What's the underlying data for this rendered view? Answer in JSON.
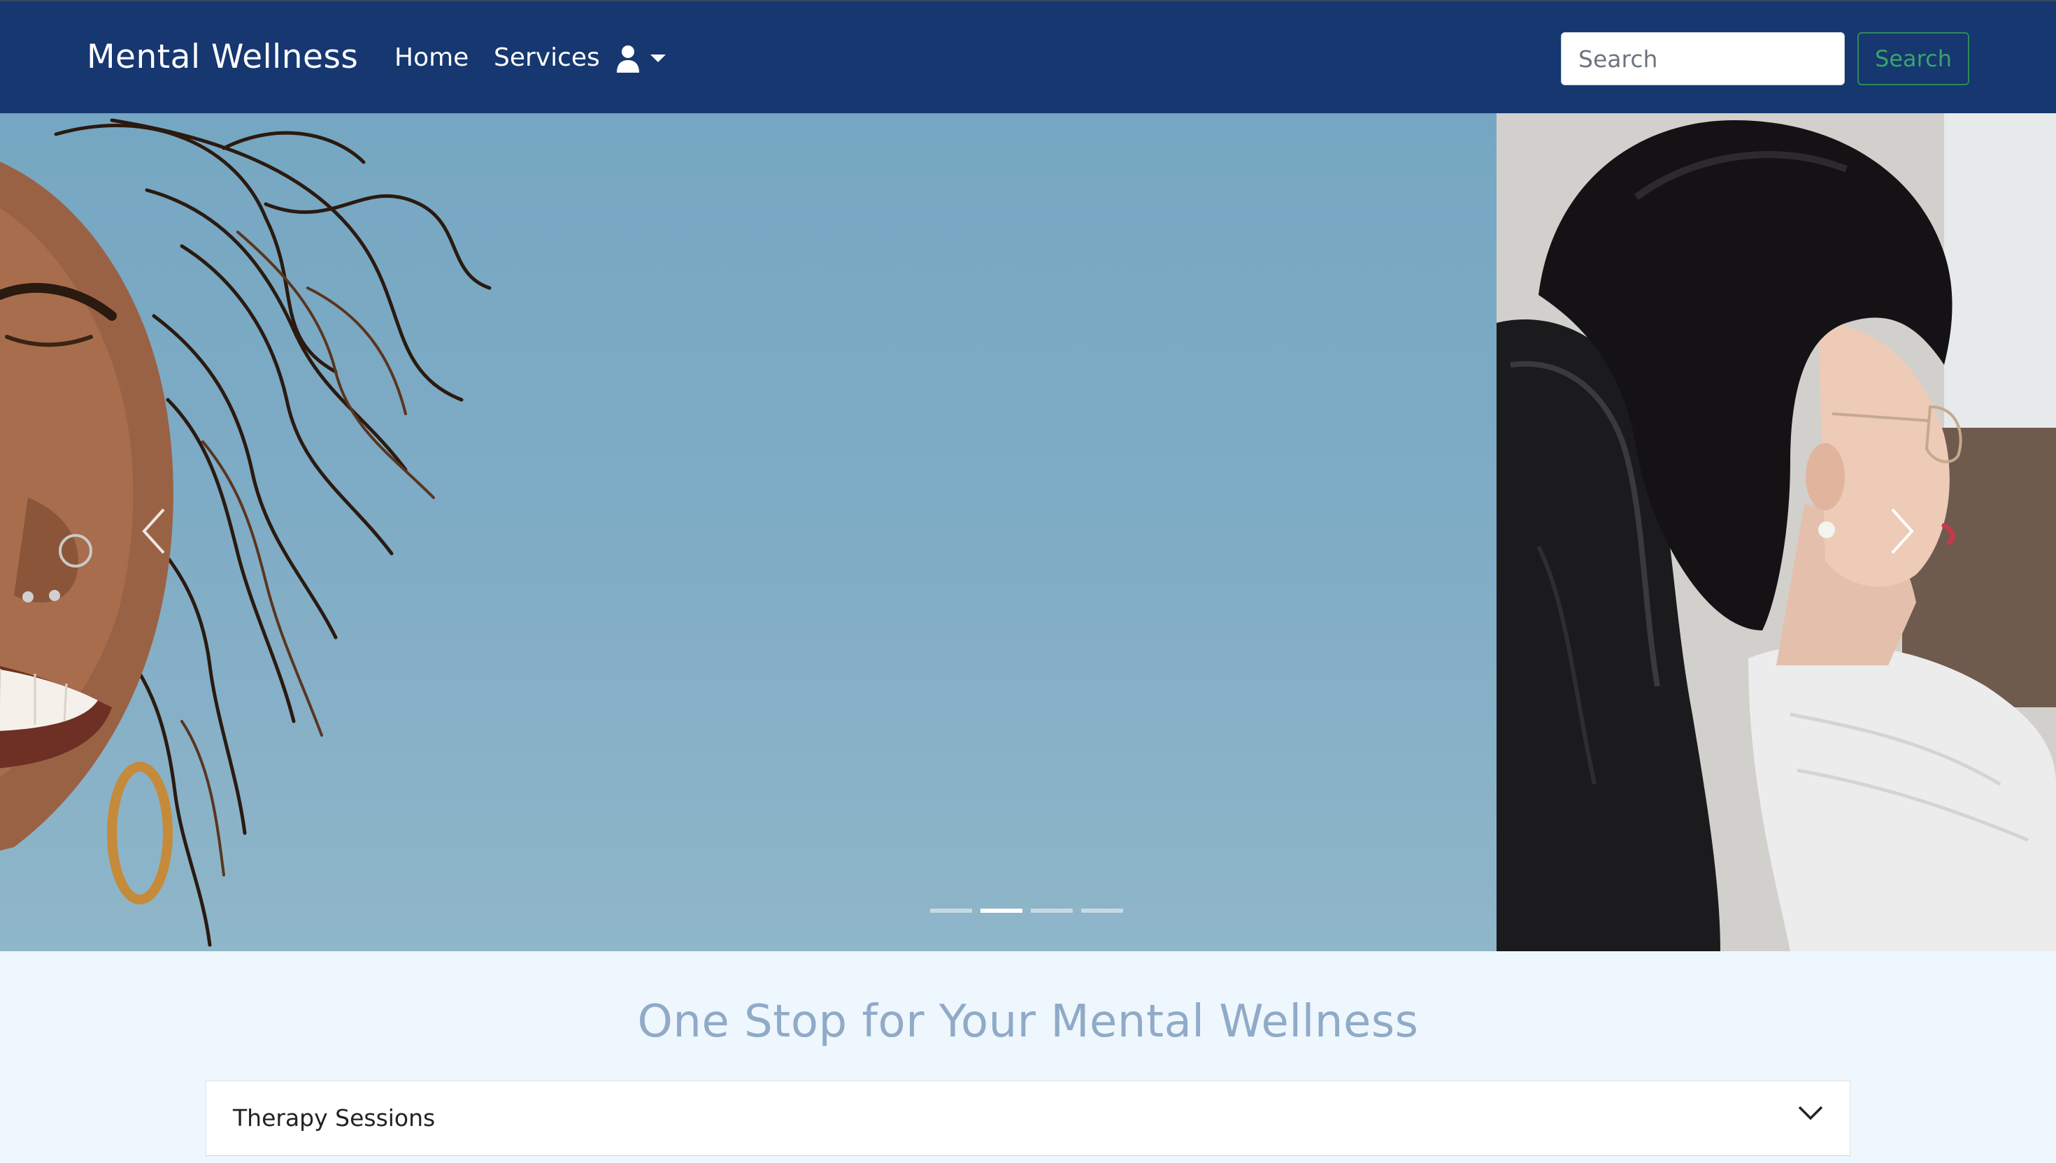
{
  "navbar": {
    "brand": "Mental Wellness",
    "links": [
      {
        "label": "Home"
      },
      {
        "label": "Services"
      }
    ],
    "user_menu_icon": "user-icon",
    "dropdown_icon": "caret-down-icon",
    "search": {
      "placeholder": "Search",
      "value": "",
      "button_label": "Search"
    },
    "colors": {
      "background": "#163770",
      "search_button": "#2e8b57"
    }
  },
  "carousel": {
    "prev_icon": "chevron-left-icon",
    "next_icon": "chevron-right-icon",
    "slide_count": 4,
    "active_index": 1
  },
  "main": {
    "headline": "One Stop for Your Mental Wellness",
    "accordion": [
      {
        "title": "Therapy Sessions",
        "icon": "chevron-down-icon",
        "expanded": false
      }
    ]
  }
}
